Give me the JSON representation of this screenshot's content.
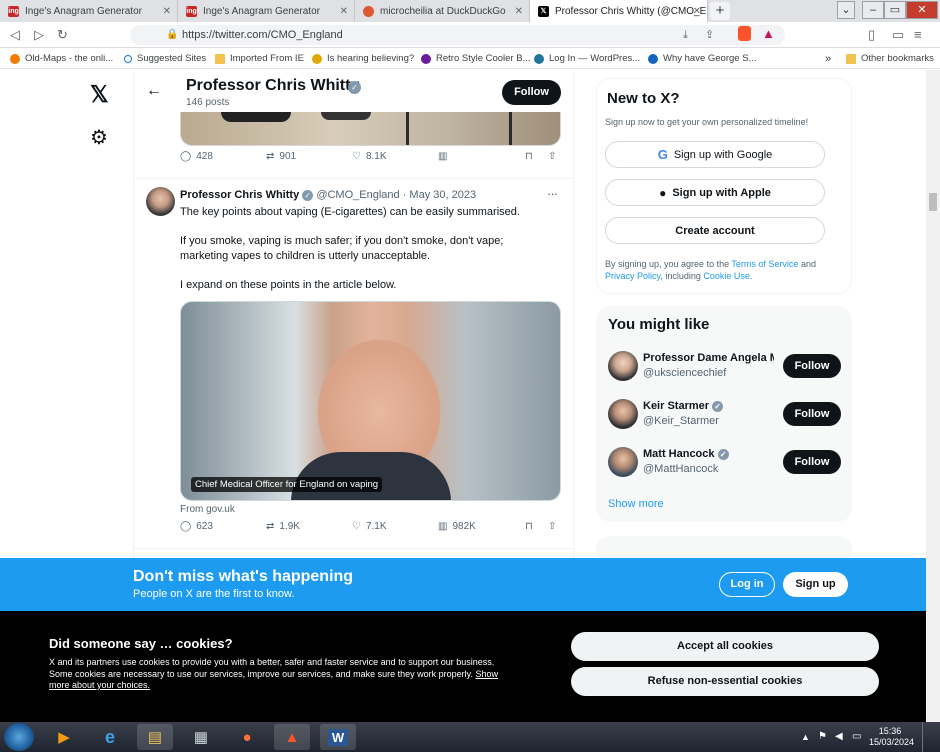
{
  "browser": {
    "tabs": [
      {
        "title": "Inge's Anagram Generator",
        "favicon": "ing"
      },
      {
        "title": "Inge's Anagram Generator",
        "favicon": "ing"
      },
      {
        "title": "microcheilia at DuckDuckGo",
        "favicon": "duckduckgo"
      },
      {
        "title": "Professor Chris Whitty (@CMO_E",
        "favicon": "x"
      }
    ],
    "url": "https://twitter.com/CMO_England",
    "bookmarks": [
      "Old-Maps - the onli...",
      "Suggested Sites",
      "Imported From IE",
      "Is hearing believing?",
      "Retro Style Cooler B...",
      "Log In — WordPres...",
      "Why have George S..."
    ],
    "bookmarks_overflow": "»",
    "other_bookmarks": "Other bookmarks"
  },
  "profile": {
    "name": "Professor Chris Whitty",
    "posts": "146 posts",
    "follow_label": "Follow"
  },
  "prev_tweet_stats": {
    "replies": "428",
    "retweets": "901",
    "likes": "8.1K"
  },
  "tweet": {
    "author": "Professor Chris Whitty",
    "handle": "@CMO_England",
    "date": "· May 30, 2023",
    "more": "···",
    "para1": "The key points about vaping (E-cigarettes) can be easily summarised.",
    "para2": "If you smoke, vaping is much safer; if you don't smoke, don't vape; marketing vapes to children is utterly unacceptable.",
    "para3": "I expand on these points in the article below.",
    "image_caption": "Chief Medical Officer for England on vaping",
    "source": "From gov.uk",
    "replies": "623",
    "retweets": "1.9K",
    "likes": "7.1K",
    "views": "982K"
  },
  "newto": {
    "title": "New to X?",
    "subtitle": "Sign up now to get your own personalized timeline!",
    "google": "Sign up with Google",
    "apple": "Sign up with Apple",
    "create": "Create account",
    "terms_1": "By signing up, you agree to the ",
    "terms_link": "Terms of Service",
    "terms_2": " and",
    "privacy_link": "Privacy Policy",
    "terms_3": ", including ",
    "cookie_link": "Cookie Use",
    "terms_4": "."
  },
  "might_like": {
    "title": "You might like",
    "people": [
      {
        "name": "Professor Dame Angela M",
        "handle": "@uksciencechief",
        "verified": false
      },
      {
        "name": "Keir Starmer",
        "handle": "@Keir_Starmer",
        "verified": true
      },
      {
        "name": "Matt Hancock",
        "handle": "@MattHancock",
        "verified": true
      }
    ],
    "follow_label": "Follow",
    "show_more": "Show more"
  },
  "signup_bar": {
    "title": "Don't miss what's happening",
    "subtitle": "People on X are the first to know.",
    "login": "Log in",
    "signup": "Sign up"
  },
  "cookies": {
    "title": "Did someone say … cookies?",
    "body": "X and its partners use cookies to provide you with a better, safer and faster service and to support our business. Some cookies are necessary to use our services, improve our services, and make sure they work properly.",
    "link": "Show more about your choices.",
    "accept": "Accept all cookies",
    "refuse": "Refuse non-essential cookies"
  },
  "taskbar": {
    "time": "15:36",
    "date": "15/03/2024"
  },
  "colors": {
    "accent": "#1d9bf0",
    "verified": "#829aab",
    "dark": "#0f1419",
    "cookie_bg": "#000000"
  }
}
